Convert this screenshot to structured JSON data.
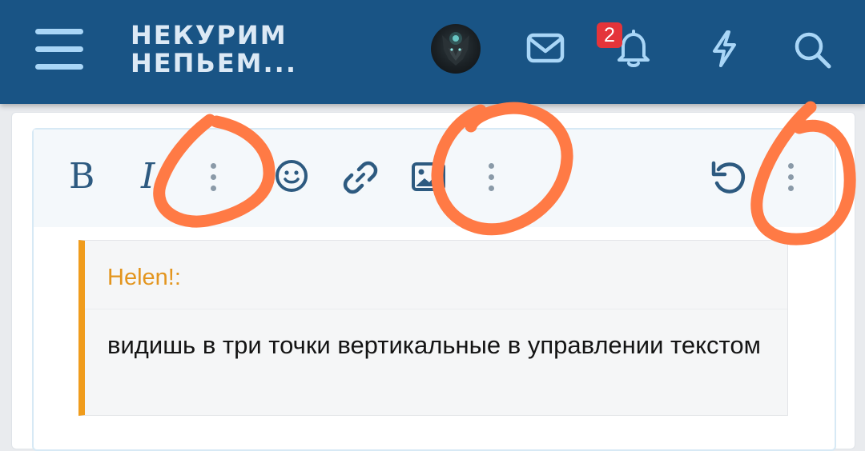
{
  "header": {
    "menu_icon": "hamburger-menu-icon",
    "site_title_line1": "НЕКУРИМ",
    "site_title_line2": "НЕПЬЕМ...",
    "notification_count": "2",
    "icons": [
      "avatar",
      "envelope-icon",
      "bell-icon",
      "lightning-icon",
      "search-icon"
    ],
    "colors": {
      "bar": "#195485",
      "icon": "#a9d6f7",
      "badge": "#e4343a"
    }
  },
  "toolbar": {
    "bold_label": "B",
    "italic_label": "I",
    "buttons": [
      "bold",
      "italic",
      "more-text-options",
      "emoji",
      "link",
      "image",
      "more-insert-options",
      "undo",
      "more-options"
    ]
  },
  "quote": {
    "author": "Helen!:",
    "text": "видишь в три точки вертикальные в управлении текстом",
    "accent_color": "#f09c1c"
  },
  "annotation": {
    "marker_color": "#ff7a45"
  }
}
